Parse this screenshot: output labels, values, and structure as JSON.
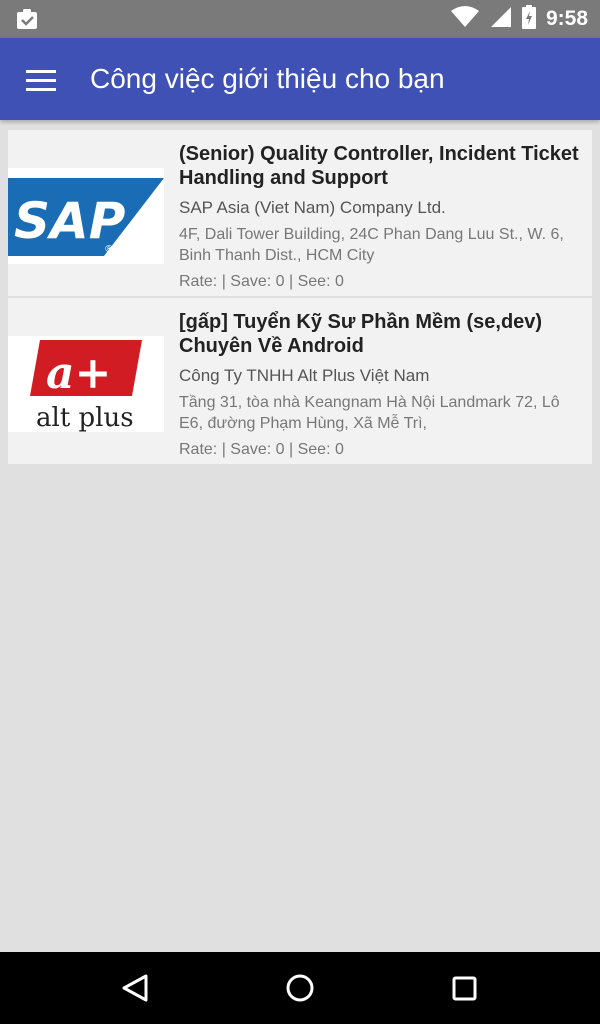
{
  "status_bar": {
    "time": "9:58",
    "icons": [
      "clipboard-check-icon",
      "wifi-icon",
      "signal-icon",
      "battery-charging-icon"
    ]
  },
  "app_bar": {
    "title": "Công việc giới thiệu cho bạn",
    "menu_icon": "hamburger-menu-icon"
  },
  "jobs": [
    {
      "title": "(Senior) Quality Controller, Incident Ticket Handling and Support",
      "company": "SAP Asia (Viet Nam) Company Ltd.",
      "address": "4F, Dali Tower Building, 24C Phan Dang Luu St., W. 6, Binh Thanh Dist., HCM City",
      "stats": "Rate:  | Save: 0 | See: 0",
      "logo_text": "SAP",
      "logo_mark": "®",
      "logo_color": "#1a6db5"
    },
    {
      "title": "[gấp] Tuyển Kỹ Sư Phần Mềm (se,dev) Chuyên Về Android",
      "company": "Công Ty TNHH Alt Plus Việt Nam",
      "address": "Tầng 31, tòa nhà Keangnam Hà Nội Landmark 72, Lô E6, đường Phạm Hùng, Xã Mễ Trì,",
      "stats": "Rate:  | Save: 0 | See: 0",
      "logo_text": "a+",
      "logo_subtext": "alt plus",
      "logo_color": "#d21c24"
    }
  ],
  "nav_bar": {
    "icons": [
      "back-icon",
      "home-icon",
      "recents-icon"
    ]
  },
  "colors": {
    "primary": "#3f51b5",
    "status_bar": "#7a7a7a",
    "background": "#e0e0e0",
    "card": "#f2f2f2"
  }
}
